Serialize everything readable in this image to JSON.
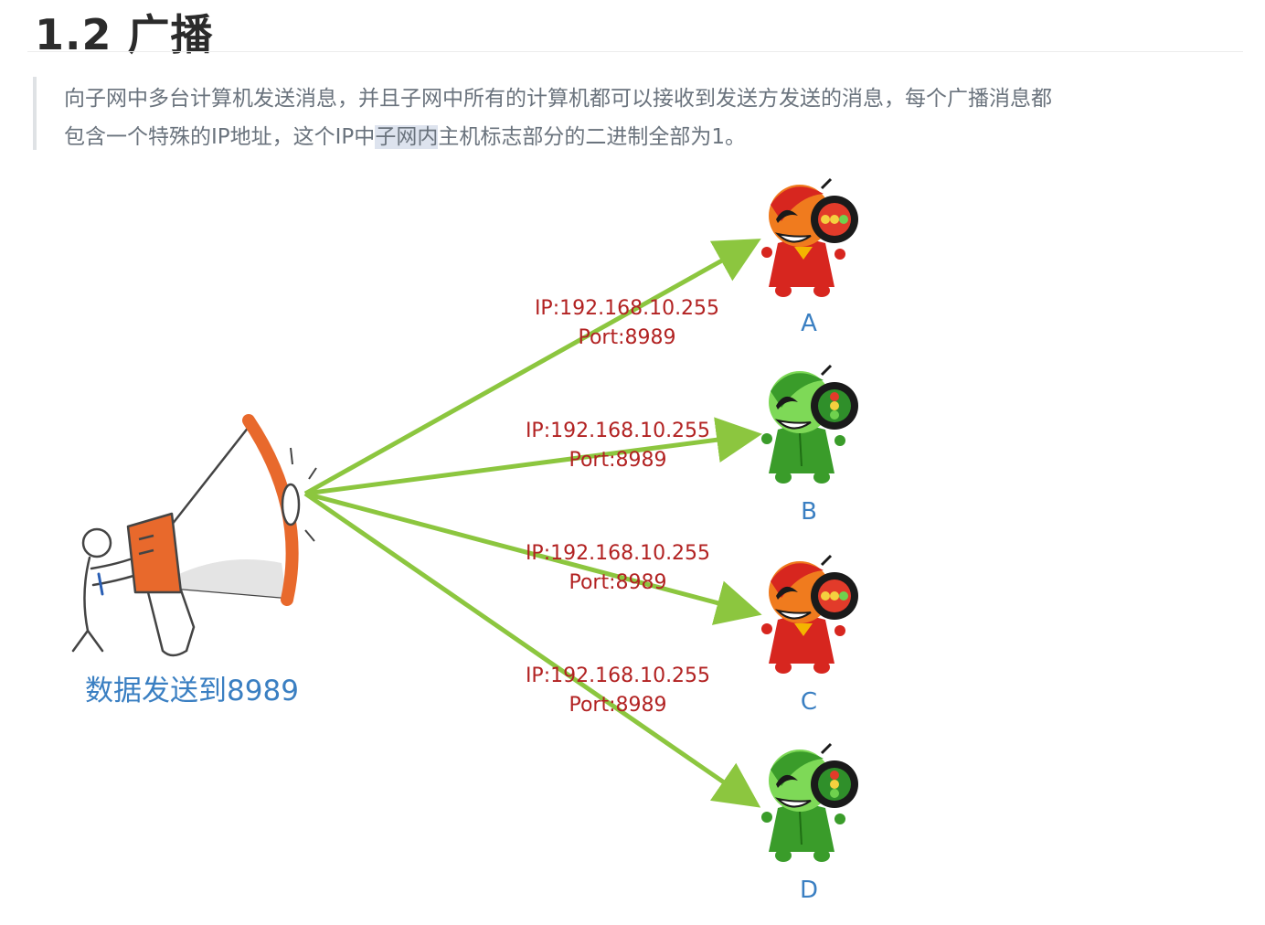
{
  "heading": "1.2 广播",
  "description": {
    "line1": "向子网中多台计算机发送消息，并且子网中所有的计算机都可以接收到发送方发送的消息，每个广播消息都",
    "line2_before": "包含一个特殊的IP地址，这个IP中",
    "line2_highlight": "子网内",
    "line2_after": "主机标志部分的二进制全部为1。"
  },
  "diagram": {
    "sender_label": "数据发送到8989",
    "receivers": [
      {
        "id": "A",
        "color": "red",
        "ip": "IP:192.168.10.255",
        "port": "Port:8989"
      },
      {
        "id": "B",
        "color": "green",
        "ip": "IP:192.168.10.255",
        "port": "Port:8989"
      },
      {
        "id": "C",
        "color": "red",
        "ip": "IP:192.168.10.255",
        "port": "Port:8989"
      },
      {
        "id": "D",
        "color": "green",
        "ip": "IP:192.168.10.255",
        "port": "Port:8989"
      }
    ],
    "colors": {
      "arrow": "#8cc63f",
      "ip_text": "#b22222",
      "node_label": "#3a7fc2",
      "sender_label": "#3a7fc2",
      "megaphone_accent": "#e8692c"
    }
  }
}
